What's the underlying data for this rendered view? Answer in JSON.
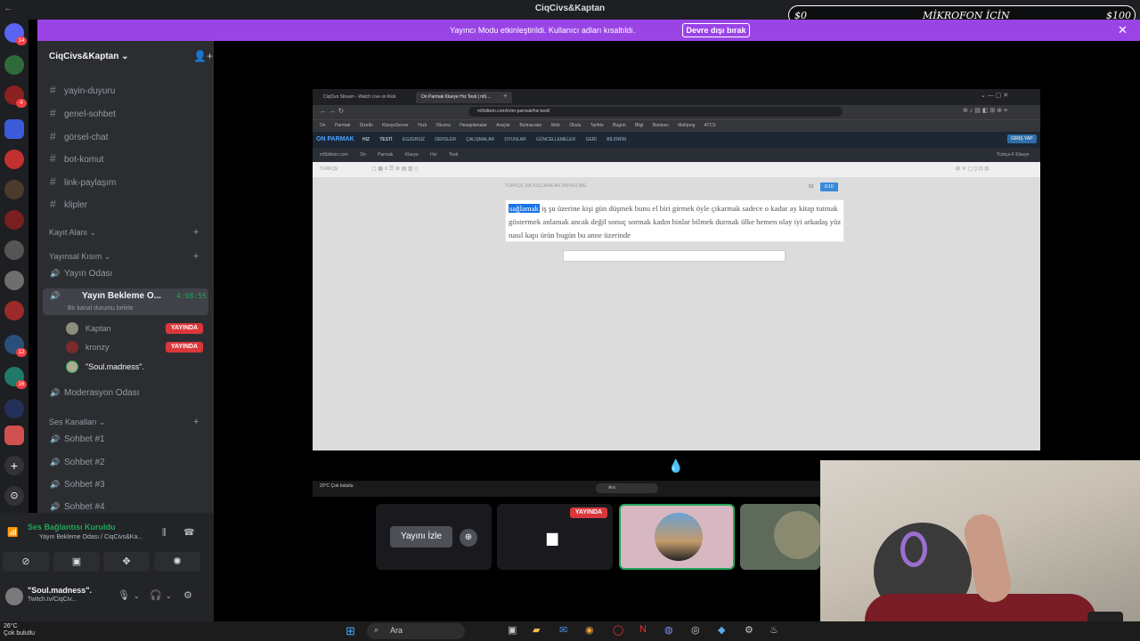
{
  "titlebar": {
    "title": "CiqCivs&Kaptan"
  },
  "overlay": {
    "left": "$0",
    "center": "MİKROFON İÇİN",
    "right": "$100"
  },
  "banner": {
    "message": "Yayıncı Modu etkinleştirildi. Kullanıcı adları kısaltıldı.",
    "button": "Devre dışı bırak"
  },
  "server": {
    "name": "CiqCivs&Kaptan"
  },
  "channels": [
    {
      "name": "yayin-duyuru"
    },
    {
      "name": "genel-sohbet"
    },
    {
      "name": "görsel-chat"
    },
    {
      "name": "bot-komut"
    },
    {
      "name": "link-paylaşım"
    },
    {
      "name": "klipler"
    }
  ],
  "categories": {
    "kayit": "Kayıt Alanı",
    "yayinsal": "Yayınsal Kısım",
    "ses": "Ses Kanalları"
  },
  "yayin_odasi": "Yayın Odası",
  "bekleme": {
    "name": "Yayın Bekleme O...",
    "timer": "4:08:55",
    "status": "Bir kanal durumu belirle",
    "users": [
      {
        "name": "Kaptan",
        "live": "YAYINDA"
      },
      {
        "name": "kronzy",
        "live": "YAYINDA"
      },
      {
        "name": "\"Soul.madness\"."
      }
    ]
  },
  "moderasyon": "Moderasyon Odası",
  "voice_channels": [
    "Sohbet #1",
    "Sohbet #2",
    "Sohbet #3",
    "Sohbet #4"
  ],
  "connection": {
    "title": "Ses Bağlantısı Kuruldu",
    "subtitle": "Yayın Bekleme Odası / CiqCivs&Ka..."
  },
  "me": {
    "name": "\"Soul.madness\".",
    "sub": "Twitch.tv/CiqCiv..."
  },
  "browser": {
    "tab1": "CiqCivs Stream - Watch Live on Kick",
    "tab2": "On Parmak Klavye Hız Testi | m5...",
    "url": "m5bilisim.com/tr/on-parmak/hiz-testi/",
    "bookmarks": [
      "On Parmak",
      "Dizello",
      "KlavyeServer",
      "Hızlı Okuma",
      "Hesaplamalar",
      "Araçlar",
      "Bulmacalar",
      "Web Okulu",
      "Tarihte Bugün",
      "Bilgi Bankası",
      "Mahjong",
      "ATCS"
    ],
    "site_logo": "ON PARMAK",
    "site_nav": [
      "HIZ TESTİ",
      "EGZERSİZ",
      "DERSLER",
      "ÇALIŞMALAR",
      "OYUNLAR",
      "GÜNCELLEMELER",
      "GERİ BİLDİRİM"
    ],
    "crumbs": [
      "m5bilisim.com",
      "On Parmak",
      "Klavye Hız Testi"
    ],
    "lang": "TÜRKÇE",
    "card_title": "TÜRKÇE SIK KULLANILAN 200 KELİME",
    "words_hl": "sağlamak",
    "words": " iş şu üzerine kişi gün düşmek bunu el biri girmek öyle çıkarmak sadece o kadar ay kitap tutmak göstermek anlamak ancak değil sonuç sormak kadın binlar bilmek durmak ülke hemen olay iyi arkadaş yüz nasıl kapı ürün bugün bu anne üzerinde",
    "counter": "53",
    "timer": "0:10",
    "right_link": "Türkçe-F Klavye",
    "top_btn": "GİRİŞ YAP",
    "inner_weather": "20°C Çok bulutlu",
    "inner_search": "Ara"
  },
  "tiles": {
    "watch": "Yayını İzle",
    "live": "YAYINDA"
  },
  "taskbar": {
    "temp": "26°C",
    "weather": "Çok bulutlu",
    "search": "Ara"
  }
}
